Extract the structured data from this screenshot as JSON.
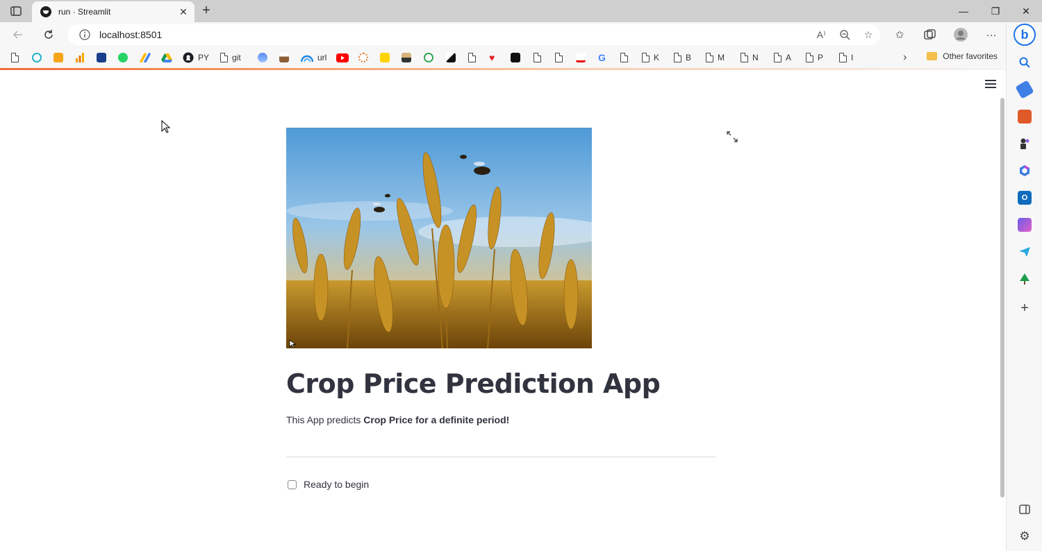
{
  "browser": {
    "tab_title": "run · Streamlit",
    "url": "localhost:8501",
    "favorites": [
      {
        "label": "",
        "icon": "page-icon"
      },
      {
        "label": "",
        "icon": "bookmark-icon-1"
      },
      {
        "label": "",
        "icon": "bookmark-icon-2"
      },
      {
        "label": "",
        "icon": "chart-icon"
      },
      {
        "label": "",
        "icon": "ieee-icon"
      },
      {
        "label": "",
        "icon": "whatsapp-icon"
      },
      {
        "label": "",
        "icon": "ads-icon"
      },
      {
        "label": "",
        "icon": "drive-icon"
      },
      {
        "label": "PY",
        "icon": "github-icon"
      },
      {
        "label": "git",
        "icon": "page-icon"
      },
      {
        "label": "",
        "icon": "bookmark-icon-3"
      },
      {
        "label": "",
        "icon": "bookmark-icon-4"
      },
      {
        "label": "url",
        "icon": "wave-icon"
      },
      {
        "label": "",
        "icon": "youtube-icon"
      },
      {
        "label": "",
        "icon": "bookmark-icon-5"
      },
      {
        "label": "",
        "icon": "bookmark-icon-6"
      },
      {
        "label": "",
        "icon": "bookmark-icon-7"
      },
      {
        "label": "",
        "icon": "bookmark-icon-8"
      },
      {
        "label": "",
        "icon": "bookmark-icon-9"
      },
      {
        "label": "",
        "icon": "page-icon"
      },
      {
        "label": "",
        "icon": "heart-icon"
      },
      {
        "label": "",
        "icon": "bookmark-icon-10"
      },
      {
        "label": "",
        "icon": "page-icon"
      },
      {
        "label": "",
        "icon": "page-icon"
      },
      {
        "label": "",
        "icon": "airtel-icon"
      },
      {
        "label": "",
        "icon": "google-icon"
      },
      {
        "label": "",
        "icon": "page-icon"
      },
      {
        "label": "K",
        "icon": "page-icon"
      },
      {
        "label": "B",
        "icon": "page-icon"
      },
      {
        "label": "M",
        "icon": "page-icon"
      },
      {
        "label": "N",
        "icon": "page-icon"
      },
      {
        "label": "A",
        "icon": "page-icon"
      },
      {
        "label": "P",
        "icon": "page-icon"
      },
      {
        "label": "I",
        "icon": "page-icon"
      }
    ],
    "other_favorites": "Other favorites"
  },
  "app": {
    "title": "Crop Price Prediction App",
    "description_prefix": "This App predicts ",
    "description_bold": "Crop Price for a definite period!",
    "checkbox_label": "Ready to begin",
    "checkbox_checked": false
  },
  "colors": {
    "text": "#31333f",
    "accent_line": "#f36b3e",
    "bing": "#1a73e8"
  }
}
